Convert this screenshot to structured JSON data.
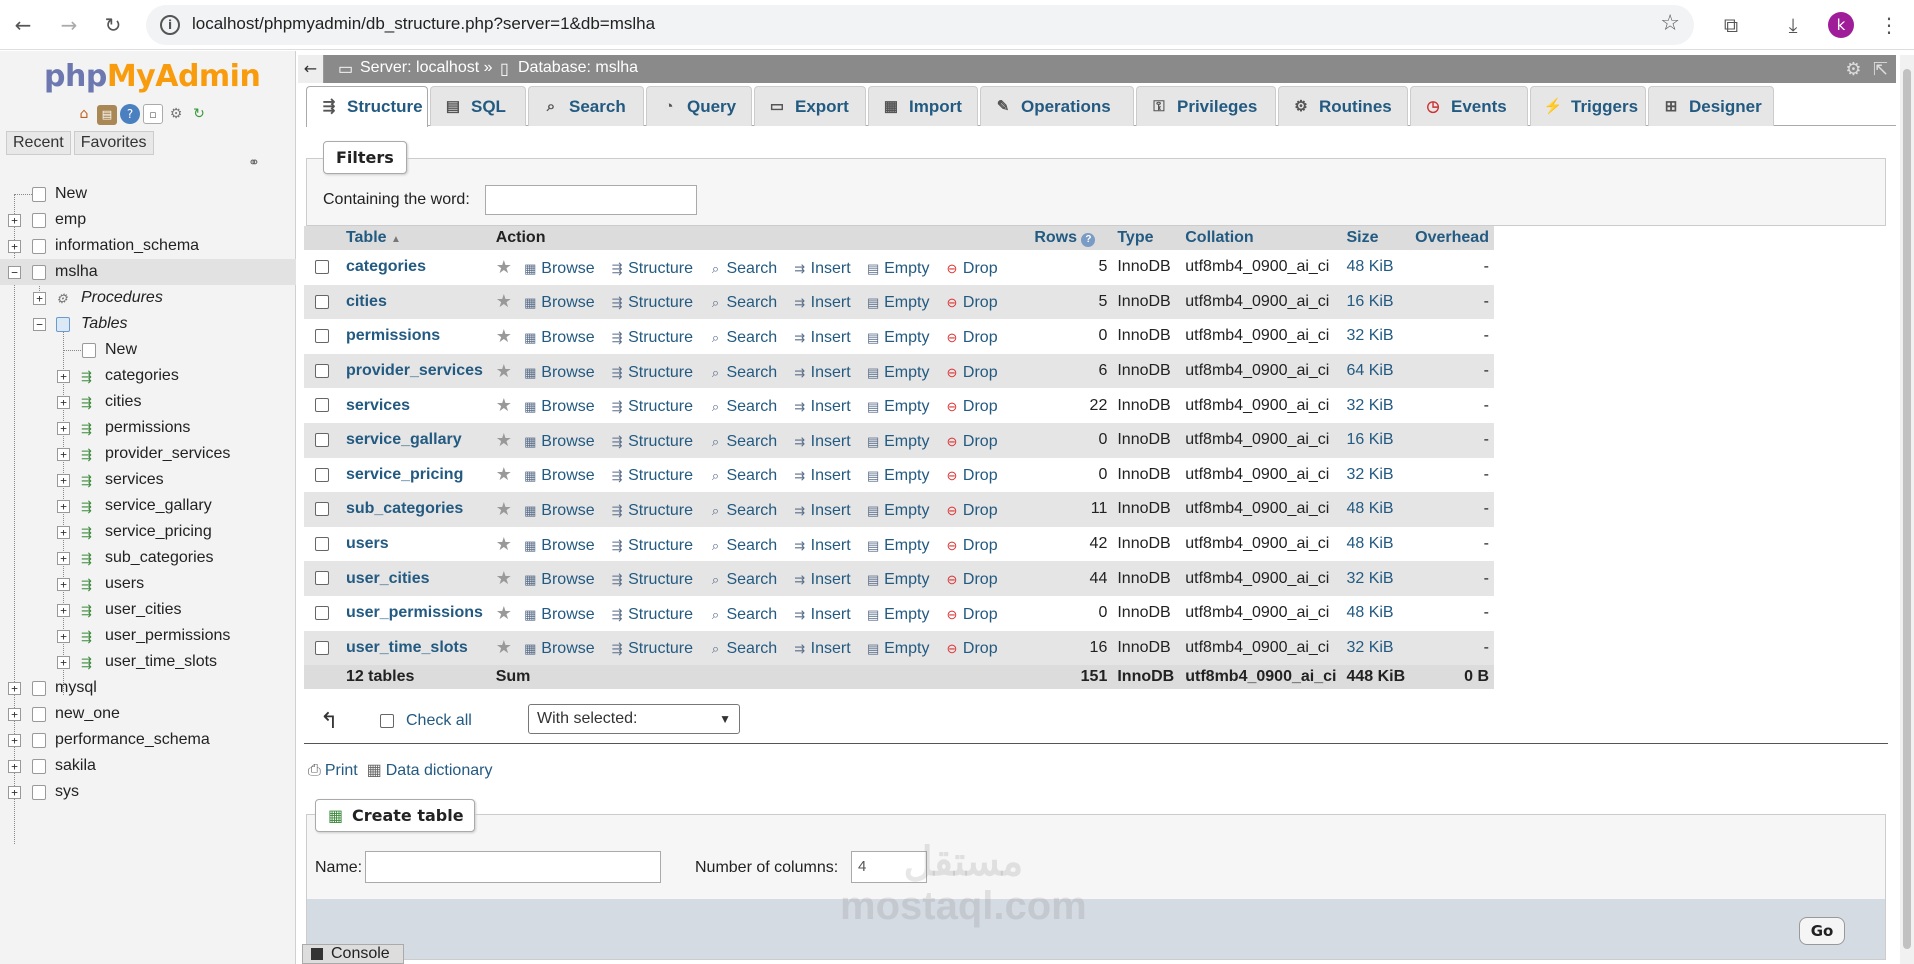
{
  "browser": {
    "url": "localhost/phpmyadmin/db_structure.php?server=1&db=mslha",
    "profile_initial": "k"
  },
  "sidebar": {
    "logo_php": "php",
    "logo_my": "My",
    "logo_admin": "Admin",
    "quick_tabs": [
      "Recent",
      "Favorites"
    ],
    "tree": [
      {
        "label": "New",
        "level": 0,
        "type": "new"
      },
      {
        "label": "emp",
        "level": 0,
        "type": "db"
      },
      {
        "label": "information_schema",
        "level": 0,
        "type": "db"
      },
      {
        "label": "mslha",
        "level": 0,
        "type": "db",
        "active": true
      },
      {
        "label": "Procedures",
        "level": 1,
        "type": "group"
      },
      {
        "label": "Tables",
        "level": 1,
        "type": "group"
      },
      {
        "label": "New",
        "level": 2,
        "type": "new"
      },
      {
        "label": "categories",
        "level": 2,
        "type": "table"
      },
      {
        "label": "cities",
        "level": 2,
        "type": "table"
      },
      {
        "label": "permissions",
        "level": 2,
        "type": "table"
      },
      {
        "label": "provider_services",
        "level": 2,
        "type": "table"
      },
      {
        "label": "services",
        "level": 2,
        "type": "table"
      },
      {
        "label": "service_gallary",
        "level": 2,
        "type": "table"
      },
      {
        "label": "service_pricing",
        "level": 2,
        "type": "table"
      },
      {
        "label": "sub_categories",
        "level": 2,
        "type": "table"
      },
      {
        "label": "users",
        "level": 2,
        "type": "table"
      },
      {
        "label": "user_cities",
        "level": 2,
        "type": "table"
      },
      {
        "label": "user_permissions",
        "level": 2,
        "type": "table"
      },
      {
        "label": "user_time_slots",
        "level": 2,
        "type": "table"
      },
      {
        "label": "mysql",
        "level": 0,
        "type": "db"
      },
      {
        "label": "new_one",
        "level": 0,
        "type": "db"
      },
      {
        "label": "performance_schema",
        "level": 0,
        "type": "db"
      },
      {
        "label": "sakila",
        "level": 0,
        "type": "db"
      },
      {
        "label": "sys",
        "level": 0,
        "type": "db"
      }
    ]
  },
  "breadcrumb": {
    "server": "Server: localhost »",
    "database": "Database: mslha"
  },
  "tabs": [
    {
      "label": "Structure",
      "icon": "structure-icon",
      "active": true
    },
    {
      "label": "SQL",
      "icon": "sql-icon"
    },
    {
      "label": "Search",
      "icon": "search-icon"
    },
    {
      "label": "Query",
      "icon": "query-icon"
    },
    {
      "label": "Export",
      "icon": "export-icon"
    },
    {
      "label": "Import",
      "icon": "import-icon"
    },
    {
      "label": "Operations",
      "icon": "wrench-icon"
    },
    {
      "label": "Privileges",
      "icon": "privileges-icon"
    },
    {
      "label": "Routines",
      "icon": "routines-icon"
    },
    {
      "label": "Events",
      "icon": "clock-icon"
    },
    {
      "label": "Triggers",
      "icon": "triggers-icon"
    },
    {
      "label": "Designer",
      "icon": "designer-icon"
    }
  ],
  "filters": {
    "legend": "Filters",
    "label": "Containing the word:",
    "value": ""
  },
  "table": {
    "headers": {
      "table": "Table",
      "action": "Action",
      "rows": "Rows",
      "type": "Type",
      "collation": "Collation",
      "size": "Size",
      "overhead": "Overhead"
    },
    "actions": [
      "Browse",
      "Structure",
      "Search",
      "Insert",
      "Empty",
      "Drop"
    ],
    "rows": [
      {
        "name": "categories",
        "rows": "5",
        "type": "InnoDB",
        "collation": "utf8mb4_0900_ai_ci",
        "size": "48 KiB",
        "overhead": "-"
      },
      {
        "name": "cities",
        "rows": "5",
        "type": "InnoDB",
        "collation": "utf8mb4_0900_ai_ci",
        "size": "16 KiB",
        "overhead": "-"
      },
      {
        "name": "permissions",
        "rows": "0",
        "type": "InnoDB",
        "collation": "utf8mb4_0900_ai_ci",
        "size": "32 KiB",
        "overhead": "-"
      },
      {
        "name": "provider_services",
        "rows": "6",
        "type": "InnoDB",
        "collation": "utf8mb4_0900_ai_ci",
        "size": "64 KiB",
        "overhead": "-"
      },
      {
        "name": "services",
        "rows": "22",
        "type": "InnoDB",
        "collation": "utf8mb4_0900_ai_ci",
        "size": "32 KiB",
        "overhead": "-"
      },
      {
        "name": "service_gallary",
        "rows": "0",
        "type": "InnoDB",
        "collation": "utf8mb4_0900_ai_ci",
        "size": "16 KiB",
        "overhead": "-"
      },
      {
        "name": "service_pricing",
        "rows": "0",
        "type": "InnoDB",
        "collation": "utf8mb4_0900_ai_ci",
        "size": "32 KiB",
        "overhead": "-"
      },
      {
        "name": "sub_categories",
        "rows": "11",
        "type": "InnoDB",
        "collation": "utf8mb4_0900_ai_ci",
        "size": "48 KiB",
        "overhead": "-"
      },
      {
        "name": "users",
        "rows": "42",
        "type": "InnoDB",
        "collation": "utf8mb4_0900_ai_ci",
        "size": "48 KiB",
        "overhead": "-"
      },
      {
        "name": "user_cities",
        "rows": "44",
        "type": "InnoDB",
        "collation": "utf8mb4_0900_ai_ci",
        "size": "32 KiB",
        "overhead": "-"
      },
      {
        "name": "user_permissions",
        "rows": "0",
        "type": "InnoDB",
        "collation": "utf8mb4_0900_ai_ci",
        "size": "48 KiB",
        "overhead": "-"
      },
      {
        "name": "user_time_slots",
        "rows": "16",
        "type": "InnoDB",
        "collation": "utf8mb4_0900_ai_ci",
        "size": "32 KiB",
        "overhead": "-"
      }
    ],
    "summary": {
      "count": "12 tables",
      "label": "Sum",
      "rows": "151",
      "type": "InnoDB",
      "collation": "utf8mb4_0900_ai_ci",
      "size": "448 KiB",
      "overhead": "0 B"
    }
  },
  "bulk": {
    "check_all": "Check all",
    "with_selected": "With selected:"
  },
  "links": {
    "print": "Print",
    "data_dictionary": "Data dictionary"
  },
  "create_table": {
    "legend": "Create table",
    "name_label": "Name:",
    "name_value": "",
    "columns_label": "Number of columns:",
    "columns_value": "4",
    "go": "Go"
  },
  "console": {
    "label": "Console"
  },
  "watermark": {
    "arabic": "مستقل",
    "latin": "mostaql.com"
  }
}
